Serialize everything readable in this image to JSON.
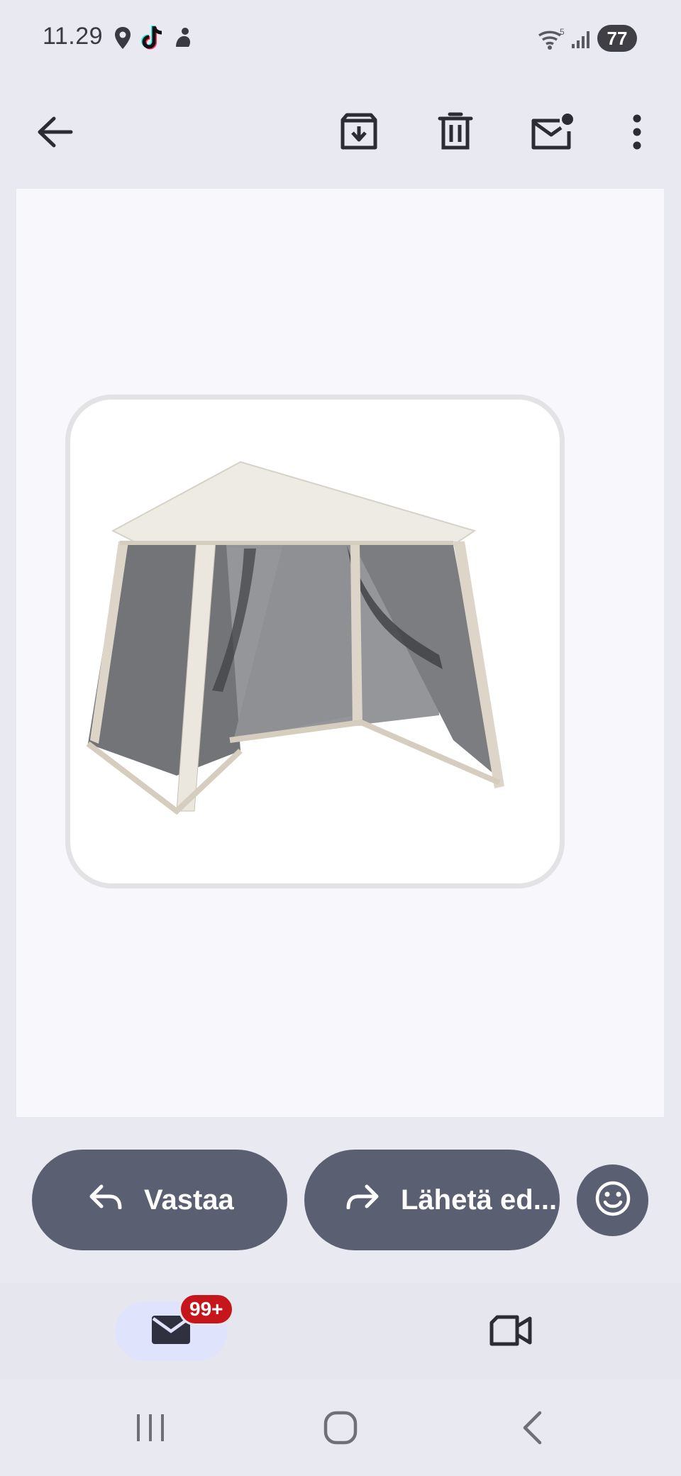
{
  "status_bar": {
    "time": "11.29",
    "battery": "77",
    "icons": [
      "location-icon",
      "tiktok-icon",
      "notification-icon",
      "wifi-5g-icon",
      "signal-icon"
    ]
  },
  "app_bar": {
    "icons": [
      "back-arrow-icon",
      "archive-icon",
      "delete-icon",
      "mark-unread-icon",
      "more-vert-icon"
    ]
  },
  "content": {
    "image": "screened-canopy-tent"
  },
  "actions": {
    "reply_label": "Vastaa",
    "forward_label": "Lähetä ed...",
    "reaction_icon": "emoji-smile-icon"
  },
  "bottom_nav": {
    "mail_badge": "99+",
    "tabs": [
      "mail-icon",
      "video-call-icon"
    ]
  },
  "system_nav": [
    "recent-apps-icon",
    "home-icon",
    "back-icon"
  ],
  "colors": {
    "action_button": "#5a5f72",
    "badge": "#c6161c",
    "active_tab": "#dfe3fb"
  }
}
